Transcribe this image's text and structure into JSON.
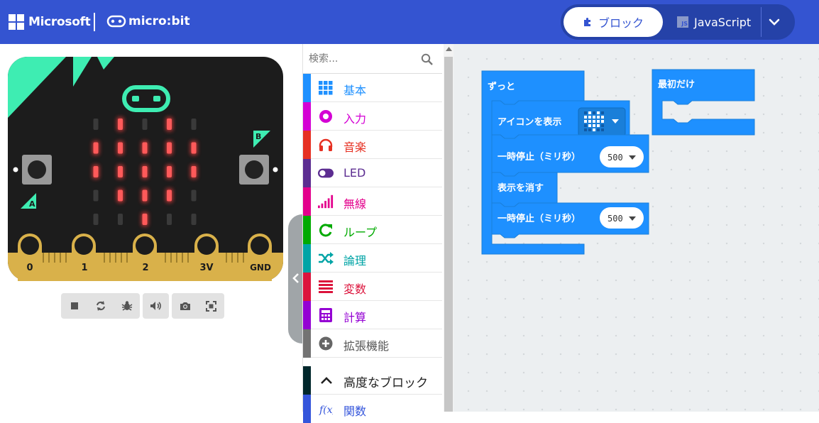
{
  "header": {
    "microsoft_label": "Microsoft",
    "microbit_label": "micro:bit",
    "mode_blocks_label": "ブロック",
    "mode_js_label": "JavaScript",
    "js_badge": "JS",
    "colors": {
      "bar": "#3454d1",
      "accent_dark": "#2542a8"
    }
  },
  "simulator": {
    "board_color": "#1c1c1c",
    "accent_color": "#3eedb2",
    "led_on_color": "#e03a3a",
    "buttons": {
      "a_label": "A",
      "b_label": "B"
    },
    "pins": [
      "0",
      "1",
      "2",
      "3V",
      "GND"
    ],
    "led_matrix": [
      [
        0,
        1,
        0,
        1,
        0
      ],
      [
        1,
        1,
        1,
        1,
        1
      ],
      [
        1,
        1,
        1,
        1,
        1
      ],
      [
        0,
        1,
        1,
        1,
        0
      ],
      [
        0,
        0,
        1,
        0,
        0
      ]
    ],
    "toolbar_icons": [
      "stop-icon",
      "restart-icon",
      "debug-icon",
      "mute-icon",
      "screenshot-icon",
      "fullscreen-icon"
    ]
  },
  "toolbox": {
    "search_placeholder": "検索...",
    "categories": [
      {
        "label": "基本",
        "color": "#1e90ff",
        "icon": "grid-icon"
      },
      {
        "label": "入力",
        "color": "#d400d4",
        "icon": "input-icon"
      },
      {
        "label": "音楽",
        "color": "#e63022",
        "icon": "headphones-icon"
      },
      {
        "label": "LED",
        "color": "#5c2d91",
        "icon": "toggle-icon"
      },
      {
        "label": "無線",
        "color": "#e3008c",
        "icon": "signal-icon"
      },
      {
        "label": "ループ",
        "color": "#00aa00",
        "icon": "loop-icon"
      },
      {
        "label": "論理",
        "color": "#00a4a6",
        "icon": "shuffle-icon"
      },
      {
        "label": "変数",
        "color": "#dc143c",
        "icon": "lines-icon"
      },
      {
        "label": "計算",
        "color": "#9400d3",
        "icon": "calculator-icon"
      },
      {
        "label": "拡張機能",
        "color": "#737373",
        "icon": "plus-circle-icon"
      }
    ],
    "advanced_label": "高度なブロック",
    "advanced_color": "#00272b",
    "functions_label": "関数",
    "functions_color": "#3455db"
  },
  "workspace": {
    "block_color": "#1e90ff",
    "forever_label": "ずっと",
    "start_label": "最初だけ",
    "show_icon_label": "アイコンを表示",
    "pause_label": "一時停止（ミリ秒）",
    "pause_value_1": "500",
    "clear_label": "表示を消す",
    "pause_value_2": "500"
  }
}
